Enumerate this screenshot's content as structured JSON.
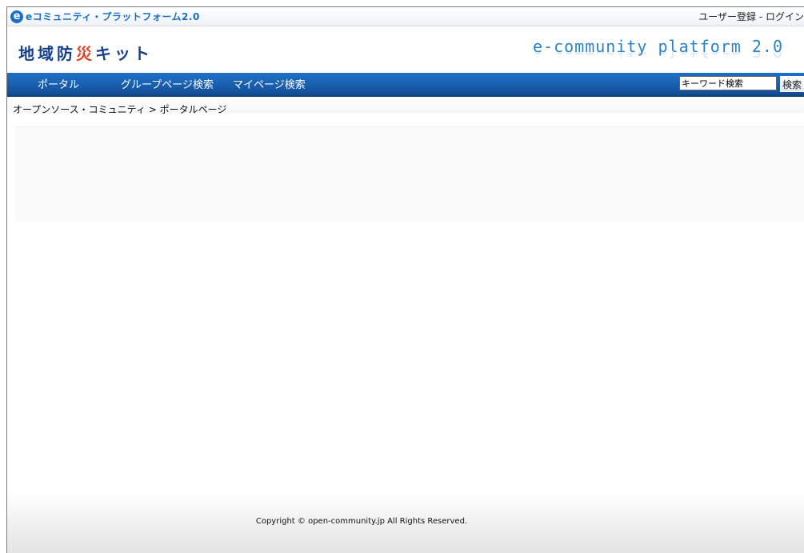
{
  "topbar": {
    "brand_icon": "e",
    "brand_text": "eコミュニティ・プラットフォーム2.0",
    "register_link": "ユーザー登録",
    "separator": " - ",
    "login_link": "ログイン"
  },
  "header": {
    "site_title_part1": "地域防",
    "site_title_accent": "災",
    "site_title_part2": "キット",
    "platform_text": "e-community platform 2.0"
  },
  "nav": {
    "items": [
      {
        "label": "ポータル"
      },
      {
        "label": "グループページ検索"
      },
      {
        "label": "マイページ検索"
      }
    ],
    "search_value": "キーワード検索",
    "search_button": "検索"
  },
  "breadcrumb": {
    "text": "オープンソース・コミュニティ > ポータルページ"
  },
  "footer": {
    "copyright": "Copyright © open-community.jp All Rights Reserved."
  },
  "colors": {
    "nav_blue": "#1b63b4",
    "brand_blue": "#1a6fc4",
    "title_navy": "#163f8c",
    "title_accent": "#e2432a"
  }
}
